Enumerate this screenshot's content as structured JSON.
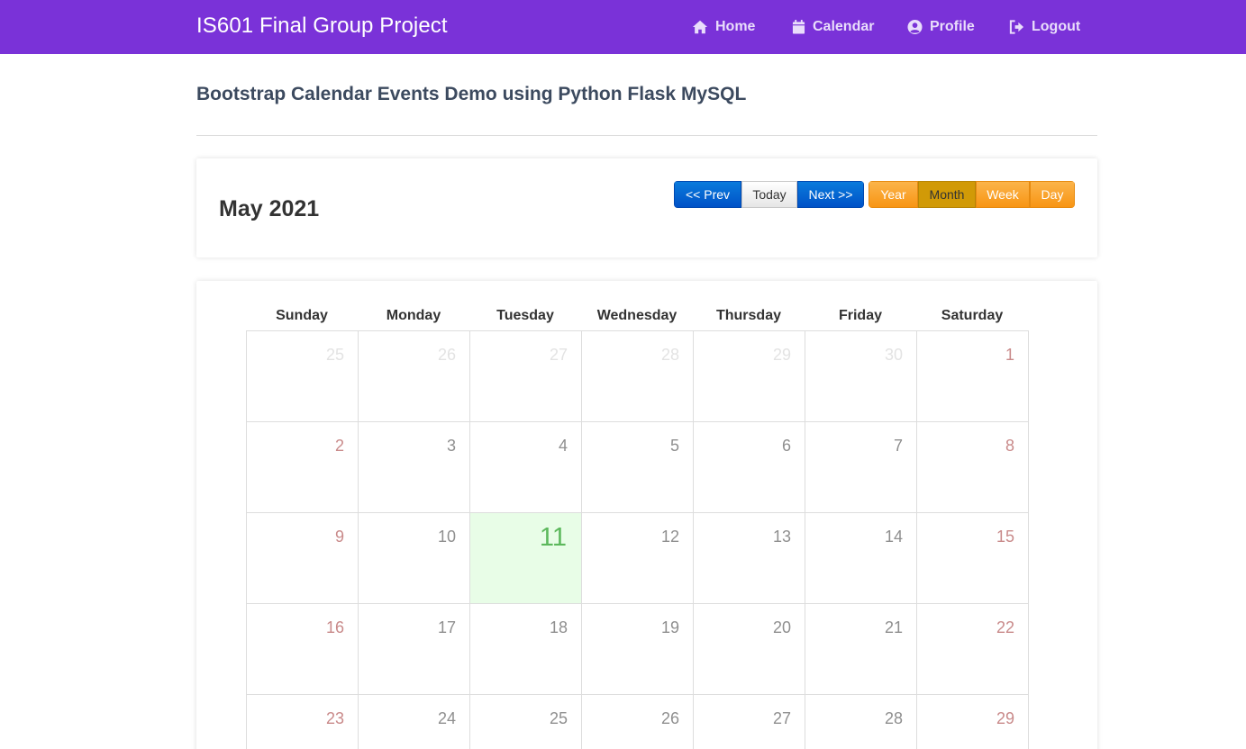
{
  "navbar": {
    "brand": "IS601 Final Group Project",
    "items": [
      {
        "label": "Home",
        "icon": "home-icon"
      },
      {
        "label": "Calendar",
        "icon": "calendar-icon"
      },
      {
        "label": "Profile",
        "icon": "user-circle-icon"
      },
      {
        "label": "Logout",
        "icon": "logout-icon"
      }
    ]
  },
  "page": {
    "title": "Bootstrap Calendar Events Demo using Python Flask MySQL"
  },
  "calendar": {
    "month_title": "May 2021",
    "nav_buttons": {
      "prev": "<< Prev",
      "today": "Today",
      "next": "Next >>"
    },
    "view_buttons": {
      "year": "Year",
      "month": "Month",
      "week": "Week",
      "day": "Day",
      "active": "Month"
    },
    "weekdays": [
      "Sunday",
      "Monday",
      "Tuesday",
      "Wednesday",
      "Thursday",
      "Friday",
      "Saturday"
    ],
    "weeks": [
      [
        "25",
        "26",
        "27",
        "28",
        "29",
        "30",
        "1"
      ],
      [
        "2",
        "3",
        "4",
        "5",
        "6",
        "7",
        "8"
      ],
      [
        "9",
        "10",
        "11",
        "12",
        "13",
        "14",
        "15"
      ],
      [
        "16",
        "17",
        "18",
        "19",
        "20",
        "21",
        "22"
      ],
      [
        "23",
        "24",
        "25",
        "26",
        "27",
        "28",
        "29"
      ]
    ],
    "today": "11"
  },
  "colors": {
    "navbar_bg": "#7a32d8",
    "primary_button": "#0052c7",
    "warning_button": "#f89514",
    "today_bg": "#e8fde7"
  }
}
